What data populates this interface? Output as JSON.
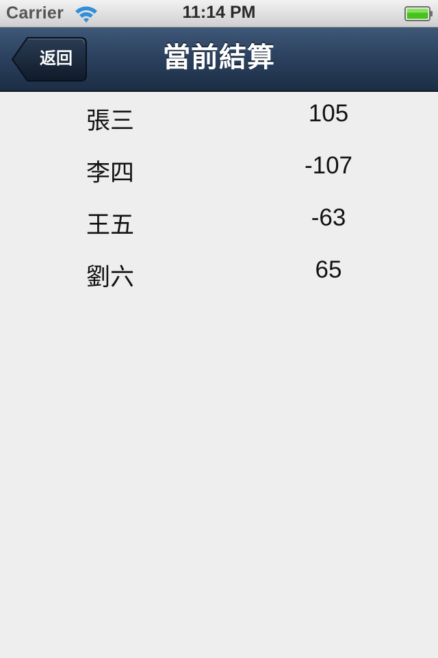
{
  "status_bar": {
    "carrier": "Carrier",
    "time": "11:14 PM",
    "battery_color": "#46c21d"
  },
  "nav": {
    "back_label": "返回",
    "title": "當前結算",
    "bar_color": "#2c4260"
  },
  "results": [
    {
      "name": "張三",
      "score": "105"
    },
    {
      "name": "李四",
      "score": "-107"
    },
    {
      "name": "王五",
      "score": "-63"
    },
    {
      "name": "劉六",
      "score": "65"
    }
  ],
  "icons": {
    "signal": "wifi-icon",
    "battery": "battery-icon",
    "back": "back-arrow-icon"
  }
}
